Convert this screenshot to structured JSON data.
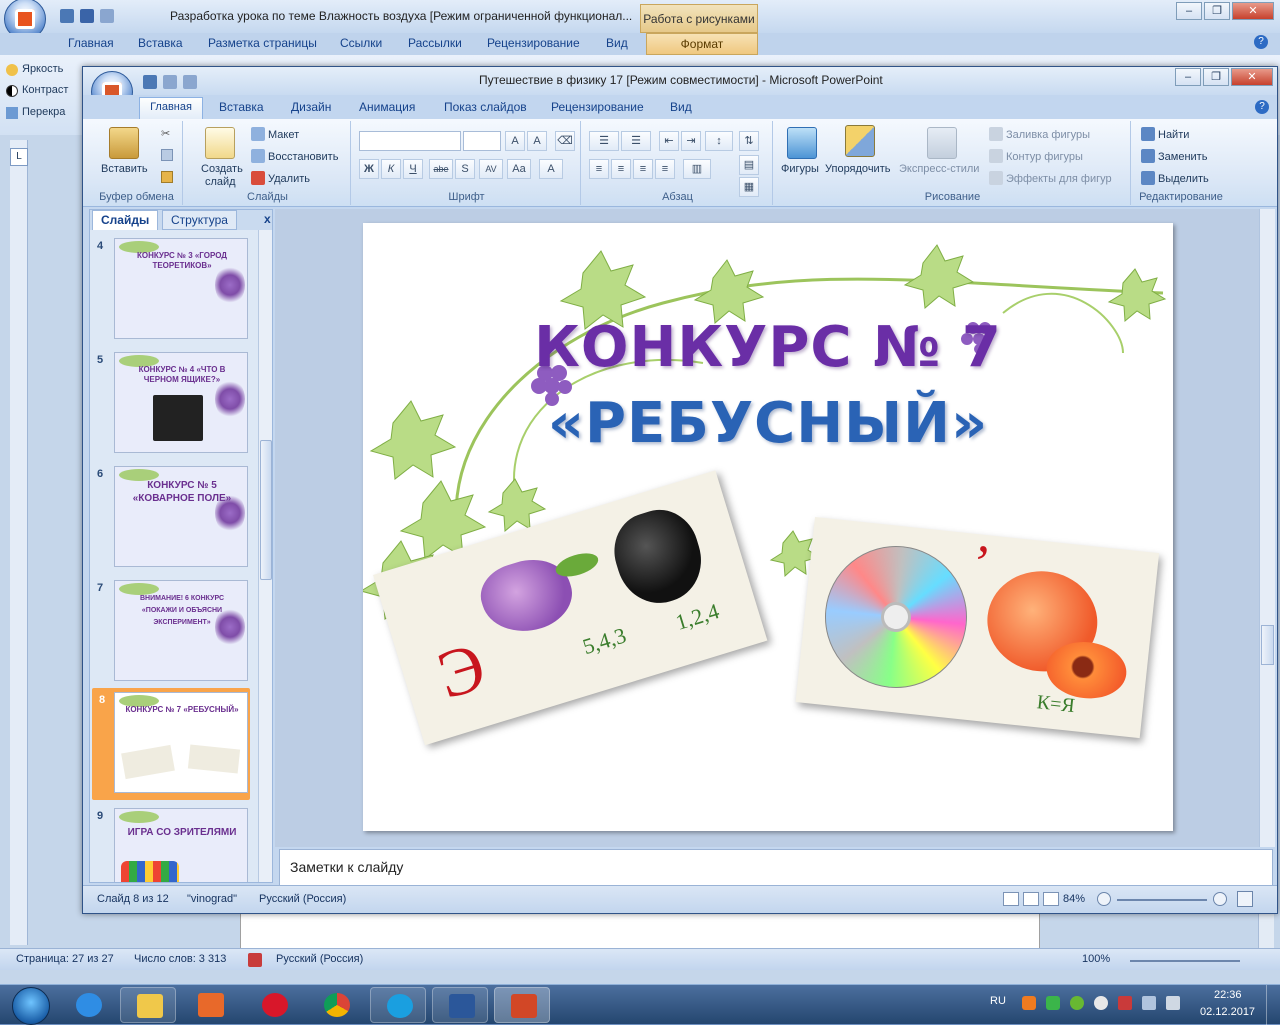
{
  "word": {
    "title": "Разработка урока по теме Влажность воздуха [Режим ограниченной функционал...",
    "context_tab": "Работа с рисунками",
    "tabs": [
      "Главная",
      "Вставка",
      "Разметка страницы",
      "Ссылки",
      "Рассылки",
      "Рецензирование",
      "Вид"
    ],
    "format_tab": "Формат",
    "left_ribbon": [
      "Яркость",
      "Контраст",
      "Перекра"
    ],
    "status": {
      "page": "Страница: 27 из 27",
      "words": "Число слов: 3 313",
      "lang": "Русский (Россия)",
      "zoom": "100%"
    }
  },
  "pp": {
    "title": "Путешествие  в физику 17 [Режим совместимости]  -  Microsoft PowerPoint",
    "tabs": [
      "Главная",
      "Вставка",
      "Дизайн",
      "Анимация",
      "Показ слайдов",
      "Рецензирование",
      "Вид"
    ],
    "ribbon": {
      "clipboard": {
        "paste": "Вставить",
        "group": "Буфер обмена"
      },
      "slides": {
        "new_slide_1": "Создать",
        "new_slide_2": "слайд",
        "layout": "Макет",
        "reset": "Восстановить",
        "delete": "Удалить",
        "group": "Слайды"
      },
      "font": {
        "group": "Шрифт",
        "buttons": [
          "Ж",
          "К",
          "Ч",
          "abe",
          "S",
          "AV",
          "Aa",
          "A"
        ]
      },
      "paragraph": {
        "group": "Абзац"
      },
      "drawing": {
        "shapes": "Фигуры",
        "arrange": "Упорядочить",
        "quick_styles": "Экспресс-стили",
        "fill": "Заливка фигуры",
        "outline": "Контур фигуры",
        "effects": "Эффекты для фигур",
        "group": "Рисование"
      },
      "editing": {
        "find": "Найти",
        "replace": "Заменить",
        "select": "Выделить",
        "group": "Редактирование"
      }
    },
    "pane_tabs": {
      "slides": "Слайды",
      "outline": "Структура",
      "close": "x"
    },
    "thumbnails": [
      {
        "num": "4",
        "caption": "КОНКУРС № 3 «ГОРОД ТЕОРЕТИКОВ»",
        "selected": false
      },
      {
        "num": "5",
        "caption": "КОНКУРС № 4 «ЧТО В ЧЕРНОМ ЯЩИКЕ?»",
        "selected": false
      },
      {
        "num": "6",
        "caption": "КОНКУРС № 5 «КОВАРНОЕ ПОЛЕ»",
        "selected": false
      },
      {
        "num": "7",
        "caption": "ВНИМАНИЕ! 6 КОНКУРС «ПОКАЖИ И ОБЪЯСНИ ЭКСПЕРИМЕНТ»",
        "selected": false
      },
      {
        "num": "8",
        "caption": "КОНКУРС № 7 «РЕБУСНЫЙ»",
        "selected": true
      },
      {
        "num": "9",
        "caption": "ИГРА СО ЗРИТЕЛЯМИ",
        "selected": false
      }
    ],
    "slide": {
      "title_line1": "КОНКУРС № 7",
      "title_line2": "«РЕБУСНЫЙ»",
      "rebus1": {
        "letter": "Э",
        "digits1": "5,4,3",
        "digits2": "1,2,4"
      },
      "rebus2": {
        "comma": "’",
        "rule": "К=Я"
      }
    },
    "notes_placeholder": "Заметки к слайду",
    "status": {
      "slide": "Слайд 8 из 12",
      "theme": "\"vinograd\"",
      "lang": "Русский (Россия)",
      "zoom": "84%"
    }
  },
  "taskbar": {
    "lang": "RU",
    "time": "22:36",
    "date": "02.12.2017"
  }
}
